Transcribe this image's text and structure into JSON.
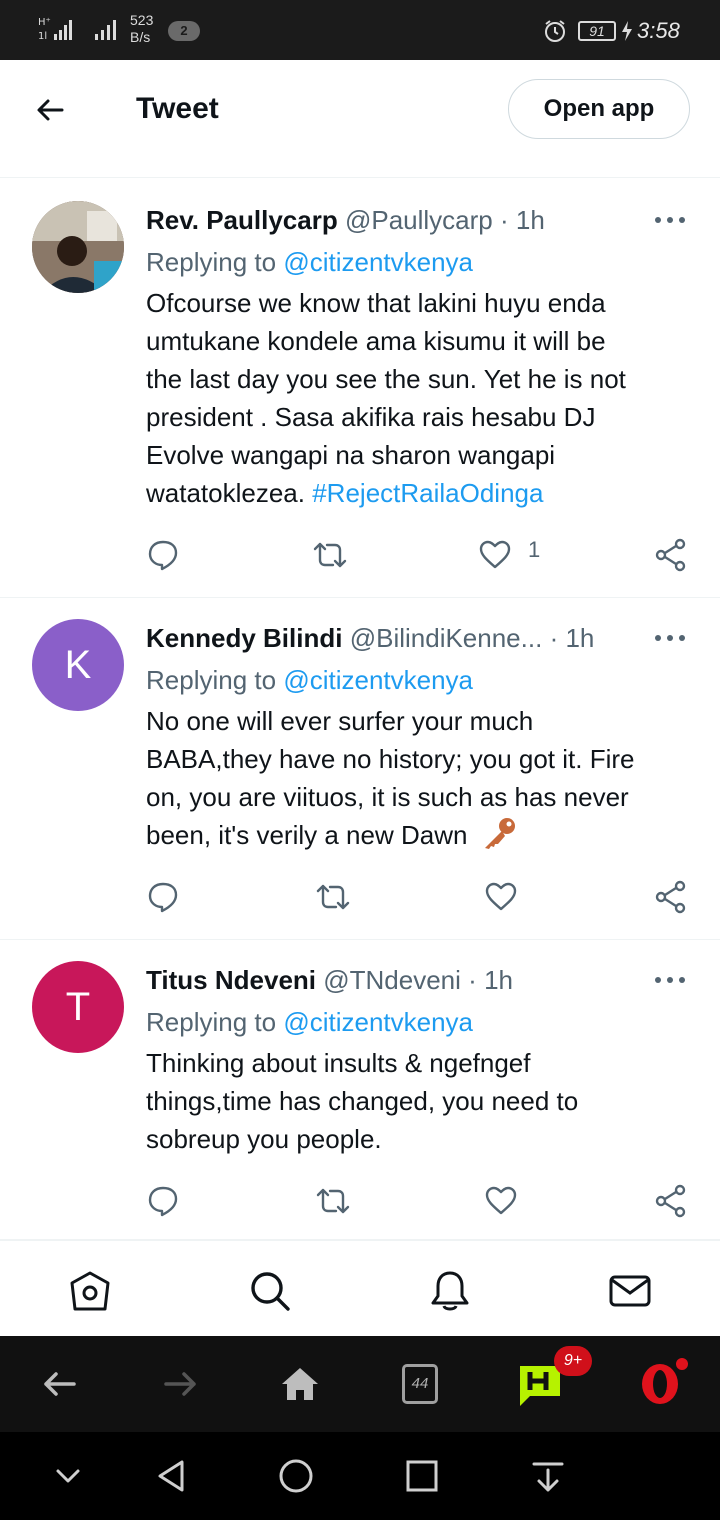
{
  "status_bar": {
    "speed_value": "523",
    "speed_unit": "B/s",
    "notification_count": "2",
    "battery": "91",
    "time": "3:58"
  },
  "header": {
    "title": "Tweet",
    "open_app_label": "Open app"
  },
  "tweets": [
    {
      "avatar_letter": "",
      "avatar_color": "#7a6a5a",
      "name": "Rev. Paullycarp",
      "handle": "@Paullycarp",
      "separator": "·",
      "time": "1h",
      "replying_prefix": "Replying to",
      "replying_to": "@citizentvkenya",
      "lines": [
        "Ofcourse we know that lakini huyu enda",
        "umtukane kondele ama kisumu it will be",
        "the last day you see the sun. Yet he is not",
        "president . Sasa akifika rais hesabu DJ",
        "Evolve wangapi na sharon wangapi"
      ],
      "last_line_text": "watatoklezea.",
      "hashtag": "#RejectRailaOdinga",
      "like_count": "1"
    },
    {
      "avatar_letter": "K",
      "avatar_color": "#8a5fc9",
      "name": "Kennedy Bilindi",
      "handle": "@BilindiKenne...",
      "separator": "·",
      "time": "1h",
      "replying_prefix": "Replying to",
      "replying_to": "@citizentvkenya",
      "lines": [
        "No one will ever surfer your much",
        "BABA,they have no history; you got it. Fire",
        "on, you are viituos, it is such as has never"
      ],
      "last_line_text": "been, it's verily a new Dawn",
      "emoji": "key-emoji",
      "like_count": ""
    },
    {
      "avatar_letter": "T",
      "avatar_color": "#c8175a",
      "name": "Titus Ndeveni",
      "handle": "@TNdeveni",
      "separator": "·",
      "time": "1h",
      "replying_prefix": "Replying to",
      "replying_to": "@citizentvkenya",
      "lines": [
        "Thinking about insults & ngefngef",
        "things,time has changed, you need to",
        "sobreup you people."
      ],
      "like_count": ""
    }
  ],
  "tabbar": {
    "icons": [
      "home-icon",
      "search-icon",
      "notifications-icon",
      "messages-icon"
    ]
  },
  "browser": {
    "tabs_count": "44",
    "badge": "9+"
  },
  "colors": {
    "accent": "#1d9bf0",
    "text": "#0f1419",
    "muted": "#536471"
  }
}
